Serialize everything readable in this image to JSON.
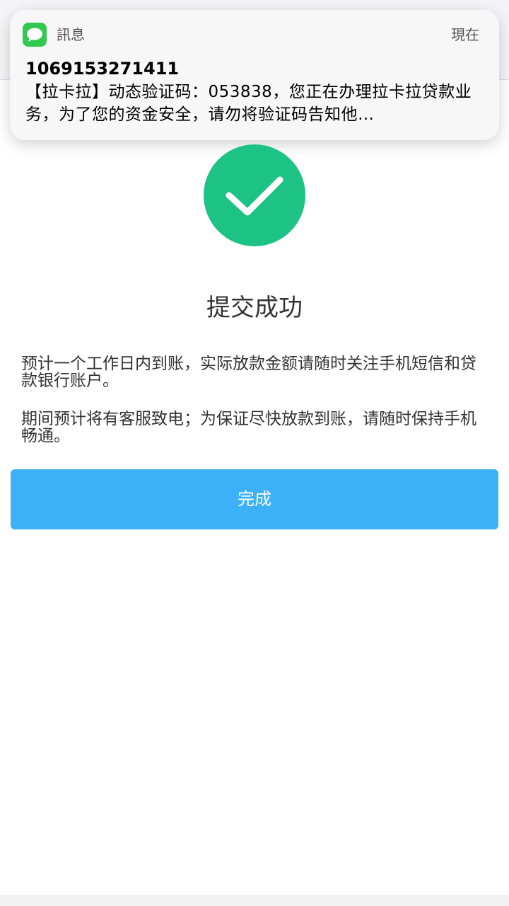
{
  "notification": {
    "app_name": "訊息",
    "time": "現在",
    "sender": "1069153271411",
    "body": "【拉卡拉】动态验证码：053838，您正在办理拉卡拉贷款业务，为了您的资金安全，请勿将验证码告知他…",
    "app_icon": "message-bubble-icon",
    "app_icon_color": "#32c850"
  },
  "result": {
    "icon": "checkmark-icon",
    "icon_color": "#1dc285",
    "title": "提交成功",
    "message_1": "预计一个工作日内到账，实际放款金额请随时关注手机短信和贷款银行账户。",
    "message_2": "期间预计将有客服致电；为保证尽快放款到账，请随时保持手机畅通。"
  },
  "actions": {
    "done_label": "完成",
    "button_color": "#3cb1f7"
  }
}
